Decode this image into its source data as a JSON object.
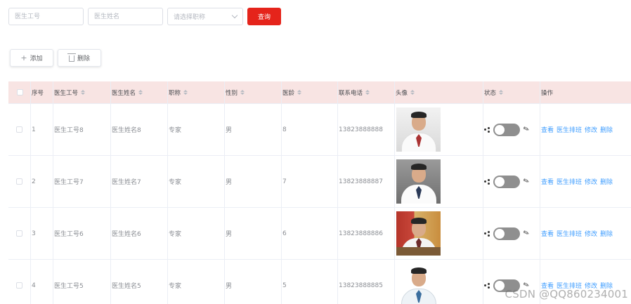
{
  "search": {
    "doctor_no_placeholder": "医生工号",
    "doctor_name_placeholder": "医生姓名",
    "title_select_placeholder": "请选择职称",
    "query_label": "查询"
  },
  "toolbar": {
    "add_label": "添加",
    "delete_label": "删除"
  },
  "table": {
    "headers": {
      "index": "序号",
      "doctor_no": "医生工号",
      "doctor_name": "医生姓名",
      "title": "职称",
      "sex": "性别",
      "age": "医龄",
      "phone": "联系电话",
      "avatar": "头像",
      "status": "状态",
      "ops": "操作"
    },
    "rows": [
      {
        "index": "1",
        "doctor_no": "医生工号8",
        "doctor_name": "医生姓名8",
        "title": "专家",
        "sex": "男",
        "age": "8",
        "phone": "13823888888"
      },
      {
        "index": "2",
        "doctor_no": "医生工号7",
        "doctor_name": "医生姓名7",
        "title": "专家",
        "sex": "男",
        "age": "7",
        "phone": "13823888887"
      },
      {
        "index": "3",
        "doctor_no": "医生工号6",
        "doctor_name": "医生姓名6",
        "title": "专家",
        "sex": "男",
        "age": "6",
        "phone": "13823888886"
      },
      {
        "index": "4",
        "doctor_no": "医生工号5",
        "doctor_name": "医生姓名5",
        "title": "专家",
        "sex": "男",
        "age": "5",
        "phone": "13823888885"
      }
    ],
    "ops": {
      "view": "查看",
      "schedule": "医生排班",
      "edit": "修改",
      "delete": "删除"
    }
  },
  "watermark": "CSDN @QQ860234001",
  "colors": {
    "accent": "#e5241b",
    "header_bg": "#f8e4e3",
    "link": "#409eff",
    "switch_off": "#8f8f8f"
  },
  "icons": [
    "chevron-down-icon",
    "plus-icon",
    "trash-icon",
    "sort-icon",
    "share-icon",
    "edit-icon"
  ]
}
